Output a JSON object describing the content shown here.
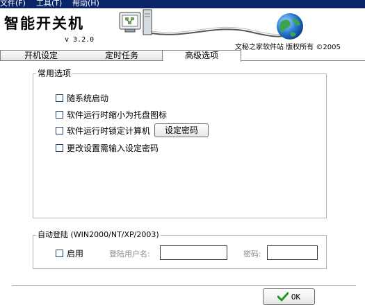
{
  "menu": {
    "items": [
      "文件(F)",
      "工具(T)",
      "帮助(H)"
    ]
  },
  "banner": {
    "title": "智能开关机",
    "version": "v 3.2.0",
    "copyright": "文秘之家软件站  版权所有  ©2005"
  },
  "tabs": [
    {
      "label": "开机设定",
      "active": false
    },
    {
      "label": "定时任务",
      "active": false
    },
    {
      "label": "高级选项",
      "active": true
    }
  ],
  "common_options": {
    "legend": "常用选项",
    "items": [
      {
        "label": "随系统启动",
        "checked": false
      },
      {
        "label": "软件运行时缩小为托盘图标",
        "checked": false
      },
      {
        "label": "软件运行时锁定计算机",
        "checked": false
      },
      {
        "label": "更改设置需输入设定密码",
        "checked": false
      }
    ],
    "set_password_button": "设定密码"
  },
  "auto_login": {
    "legend": "自动登陆 (WIN2000/NT/XP/2003)",
    "enable_label": "启用",
    "username_label": "登陆用户名:",
    "username_value": "",
    "password_label": "密码:",
    "password_value": ""
  },
  "footer": {
    "ok_label": "OK"
  },
  "colors": {
    "menubar": "#0a246a",
    "ok_check": "#1a9a1a",
    "checkbox_border": "#1c3b6e"
  }
}
